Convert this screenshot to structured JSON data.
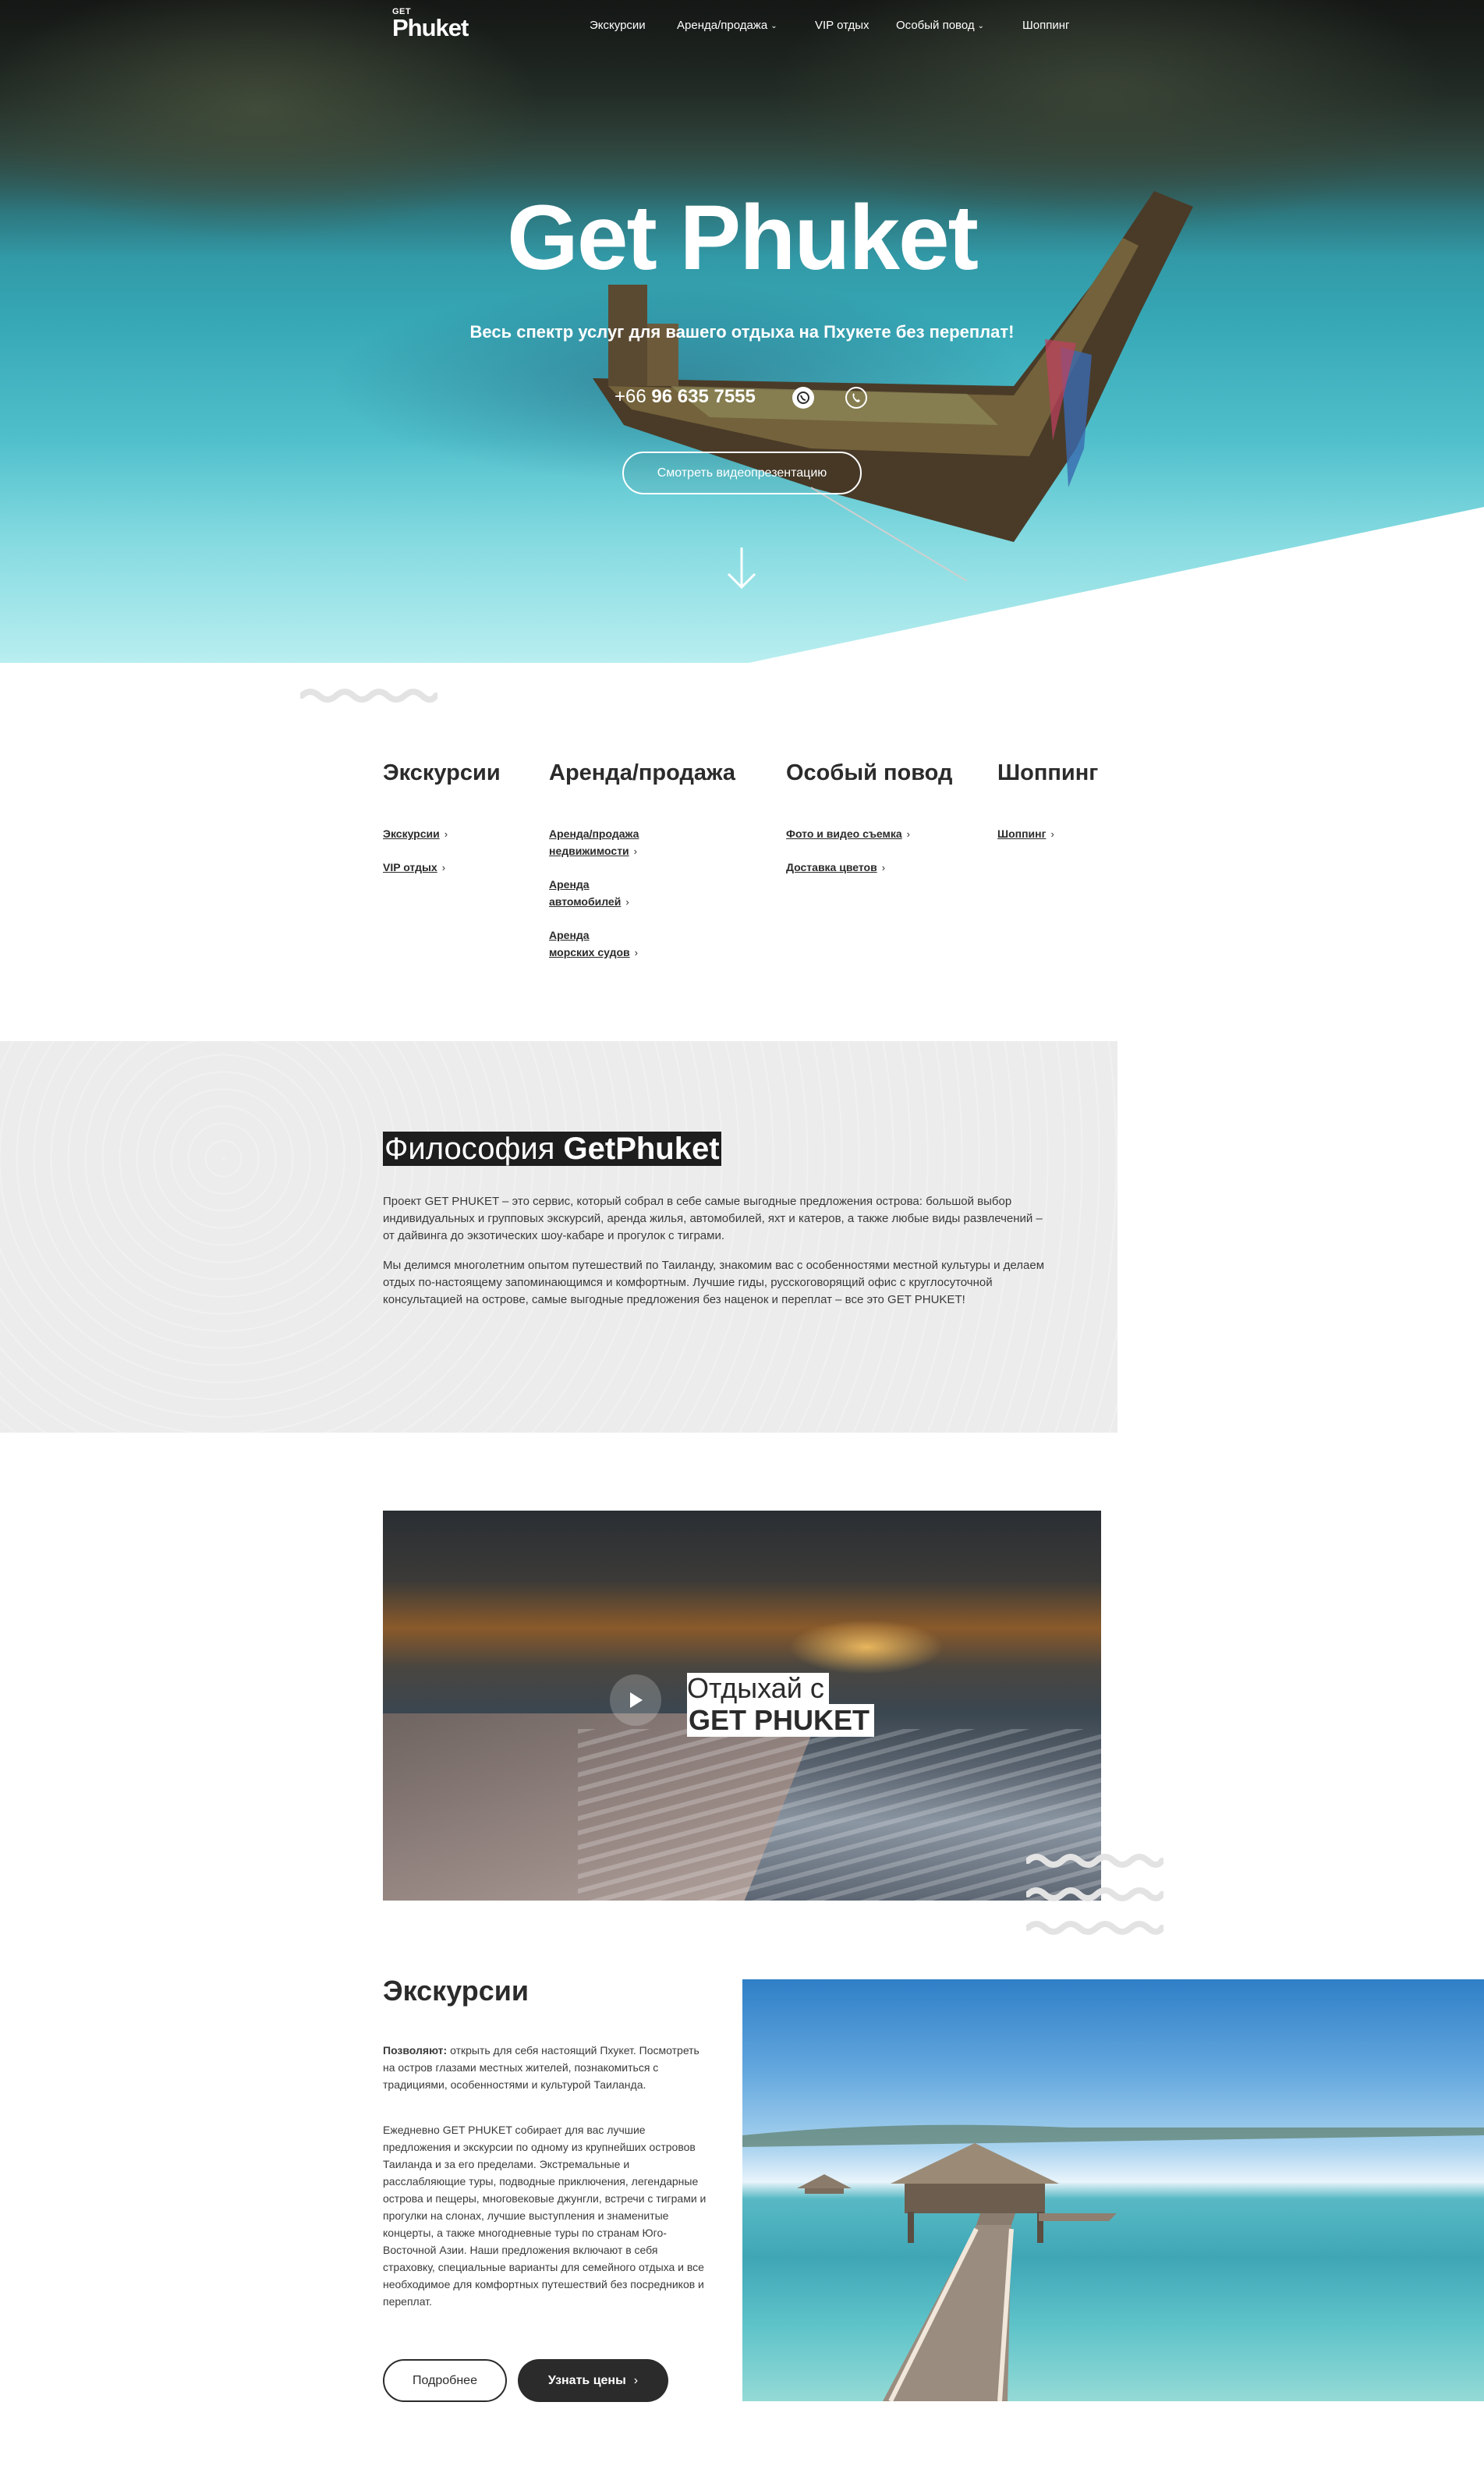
{
  "header": {
    "logo_top": "GET",
    "logo_main": "Phuket",
    "nav": [
      {
        "label": "Экскурсии",
        "has_dropdown": false
      },
      {
        "label": "Аренда/продажа",
        "has_dropdown": true
      },
      {
        "label": "VIP отдых",
        "has_dropdown": false
      },
      {
        "label": "Особый повод",
        "has_dropdown": true
      },
      {
        "label": "Шоппинг",
        "has_dropdown": false
      }
    ]
  },
  "hero": {
    "title": "Get Phuket",
    "subtitle": "Весь спектр услуг для вашего отдыха на Пхукете без переплат!",
    "phone_prefix": "+66",
    "phone_number": "96 635 7555",
    "video_button": "Смотреть видеопрезентацию"
  },
  "categories": [
    {
      "title": "Экскурсии",
      "links": [
        [
          "Экскурсии"
        ],
        [
          "VIP отдых"
        ]
      ]
    },
    {
      "title": "Аренда/продажа",
      "links": [
        [
          "Аренда/продажа",
          "недвижимости"
        ],
        [
          "Аренда",
          "автомобилей"
        ],
        [
          "Аренда",
          "морских судов"
        ]
      ]
    },
    {
      "title": "Особый повод",
      "links": [
        [
          "Фото и видео съемка"
        ],
        [
          "Доставка цветов"
        ]
      ]
    },
    {
      "title": "Шоппинг",
      "links": [
        [
          "Шоппинг"
        ]
      ]
    }
  ],
  "philosophy": {
    "title_light": "Философия ",
    "title_bold": "GetPhuket",
    "p1": "Проект GET PHUKET – это сервис, который собрал в себе самые выгодные предложения острова: большой выбор индивидуальных и групповых экскурсий, аренда жилья, автомобилей, яхт и катеров, а также любые виды развлечений – от дайвинга до экзотических шоу-кабаре и прогулок с тиграми.",
    "p2": "Мы делимся многолетним опытом путешествий по Таиланду, знакомим вас с особенностями местной культуры и делаем отдых по-настоящему запоминающимся и комфортным. Лучшие гиды, русскоговорящий офис с круглосуточной консультацией на острове, самые выгодные предложения без наценок и переплат – все это GET PHUKET!"
  },
  "video": {
    "line1": "Отдыхай с",
    "line2": "GET PHUKET"
  },
  "excursions": {
    "title": "Экскурсии",
    "lead_bold": "Позволяют:",
    "lead_text": " открыть для себя настоящий Пхукет. Посмотреть на остров глазами местных жителей, познакомиться с традициями, особенностями и культурой Таиланда.",
    "body": "Ежедневно GET PHUKET собирает для вас лучшие предложения и экскурсии по одному из крупнейших островов Таиланда и за его пределами. Экстремальные и расслабляющие туры, подводные приключения, легендарные острова и пещеры, многовековые джунгли, встречи с тиграми и прогулки на слонах, лучшие выступления и знаменитые концерты, а также многодневные туры по странам Юго-Восточной Азии. Наши предложения включают в себя страховку, специальные варианты для семейного отдыха и все необходимое для комфортных путешествий без посредников и переплат.",
    "btn_more": "Подробнее",
    "btn_price": "Узнать цены"
  },
  "colors": {
    "dark": "#2b2b2b",
    "philo_bg": "#ececec",
    "white": "#ffffff"
  }
}
